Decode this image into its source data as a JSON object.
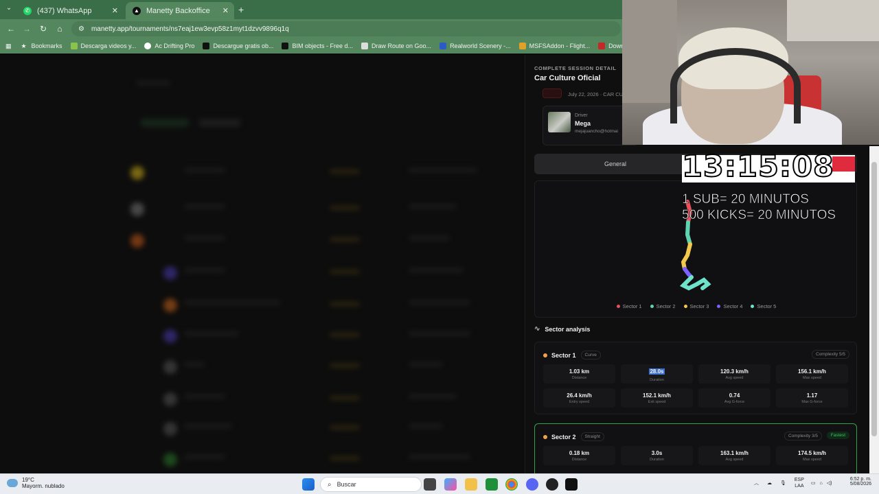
{
  "browser": {
    "tabs": [
      {
        "label": "(437) WhatsApp"
      },
      {
        "label": "Manetty Backoffice"
      }
    ],
    "url": "manetty.app/tournaments/ns7eaj1ew3evp58z1myt1dzvv9896q1q",
    "bookmarks": [
      "Bookmarks",
      "Descarga videos y...",
      "Ac Drifting Pro",
      "Descargue gratis ob...",
      "BIM objects - Free d...",
      "Draw Route on Goo...",
      "Realworld Scenery -...",
      "MSFSAddon - Flight...",
      "Downloading BMW..."
    ]
  },
  "panel": {
    "kicker": "COMPLETE SESSION DETAIL",
    "title": "Car Culture Oficial",
    "date_text": "July 22, 2026 · CAR CU",
    "driver_label": "Driver",
    "driver_name": "Mega",
    "driver_email": "mejajuancho@hotmai",
    "tab_general": "General",
    "legend": [
      "Sector 1",
      "Sector 2",
      "Sector 3",
      "Sector 4",
      "Sector 5"
    ],
    "legend_colors": [
      "#e8505b",
      "#5fd3b0",
      "#f2c94c",
      "#7b61ff",
      "#6fe3c9"
    ],
    "sector_analysis_title": "Sector analysis",
    "sectors": [
      {
        "name": "Sector 1",
        "type": "Curve",
        "complexity": "Complexity 5/5",
        "metrics": [
          {
            "value": "1.03 km",
            "label": "Distance"
          },
          {
            "value": "28.0s",
            "label": "Duration"
          },
          {
            "value": "120.3 km/h",
            "label": "Avg speed"
          },
          {
            "value": "156.1 km/h",
            "label": "Max speed"
          },
          {
            "value": "26.4 km/h",
            "label": "Entry speed"
          },
          {
            "value": "152.1 km/h",
            "label": "Exit speed"
          },
          {
            "value": "0.74",
            "label": "Avg G-force"
          },
          {
            "value": "1.17",
            "label": "Max G-force"
          }
        ]
      },
      {
        "name": "Sector 2",
        "type": "Straight",
        "complexity": "Complexity 3/5",
        "badge": "Fastest",
        "metrics": [
          {
            "value": "0.18 km",
            "label": "Distance"
          },
          {
            "value": "3.0s",
            "label": "Duration"
          },
          {
            "value": "163.1 km/h",
            "label": "Avg speed"
          },
          {
            "value": "174.5 km/h",
            "label": "Max speed"
          }
        ]
      }
    ]
  },
  "overlay": {
    "timer": "13:15:08",
    "line1": "1 SUB= 20 MINUTOS",
    "line2": "500 KICKS= 20 MINUTOS"
  },
  "taskbar": {
    "temp": "19°C",
    "weather_desc": "Mayorm. nublado",
    "search_placeholder": "Buscar",
    "lang": "ESP",
    "lang2": "LAA",
    "time": "6:52 p. m.",
    "date": "5/08/2026"
  }
}
